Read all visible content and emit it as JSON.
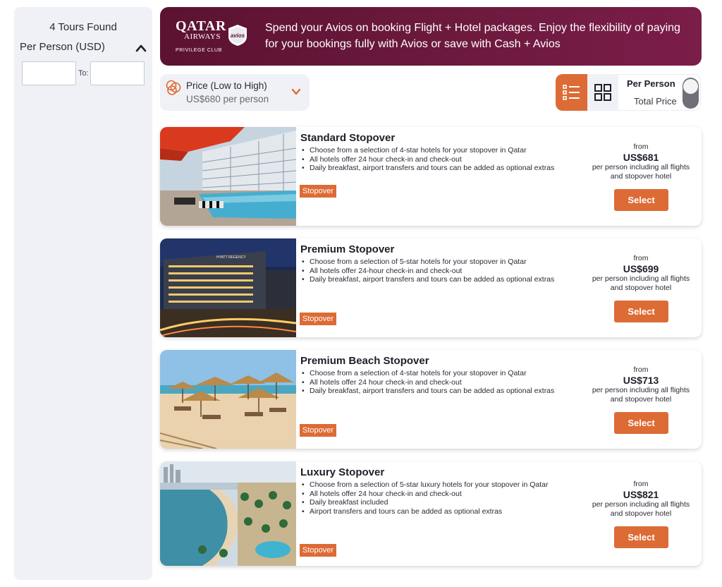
{
  "sidebar": {
    "tours_found": "4 Tours Found",
    "price_filter_label": "Per Person (USD)",
    "to_label": "To:",
    "from_value": "",
    "to_value": ""
  },
  "banner": {
    "logo": {
      "line1": "QATAR",
      "line2": "AIRWAYS",
      "line3": "PRIVILEGE CLUB",
      "badge": "avios"
    },
    "text": "Spend your Avios on booking Flight + Hotel packages. Enjoy the flexibility of paying for your bookings fully with Avios or save with Cash + Avios"
  },
  "sort": {
    "title": "Price (Low to High)",
    "subtitle": "US$680 per person",
    "icon": "coins-icon"
  },
  "view_toggle": {
    "per_person": "Per Person",
    "total_price": "Total Price",
    "active_view": "list"
  },
  "colors": {
    "accent": "#dd6b35",
    "banner": "#6e1a3f",
    "panel": "#f0f1f6"
  },
  "cards": [
    {
      "title": "Standard Stopover",
      "bullets": [
        "Choose from a selection of 4-star hotels for your stopover in Qatar",
        "All hotels offer 24 hour check-in and check-out",
        "Daily breakfast, airport transfers and tours can be added as optional extras"
      ],
      "tag": "Stopover",
      "from": "from",
      "price": "US$681",
      "price_note": "per person including all flights and stopover hotel",
      "button": "Select"
    },
    {
      "title": "Premium Stopover",
      "bullets": [
        "Choose from a selection of 5-star hotels for your stopover in Qatar",
        "All hotels offer 24-hour check-in and check-out",
        "Daily breakfast, airport transfers and tours can be added as optional extras"
      ],
      "tag": "Stopover",
      "from": "from",
      "price": "US$699",
      "price_note": "per person including all flights and stopover hotel",
      "button": "Select"
    },
    {
      "title": "Premium Beach Stopover",
      "bullets": [
        "Choose from a selection of 4-star hotels for your stopover in Qatar",
        "All hotels offer 24 hour check-in and check-out",
        "Daily breakfast, airport transfers and tours can be added as optional extras"
      ],
      "tag": "Stopover",
      "from": "from",
      "price": "US$713",
      "price_note": "per person including all flights and stopover hotel",
      "button": "Select"
    },
    {
      "title": "Luxury Stopover",
      "bullets": [
        "Choose from a selection of 5-star luxury hotels for your stopover in Qatar",
        "All hotels offer 24 hour check-in and check-out",
        "Daily breakfast included",
        "Airport transfers and tours can be added as optional extras"
      ],
      "tag": "Stopover",
      "from": "from",
      "price": "US$821",
      "price_note": "per person including all flights and stopover hotel",
      "button": "Select"
    }
  ]
}
